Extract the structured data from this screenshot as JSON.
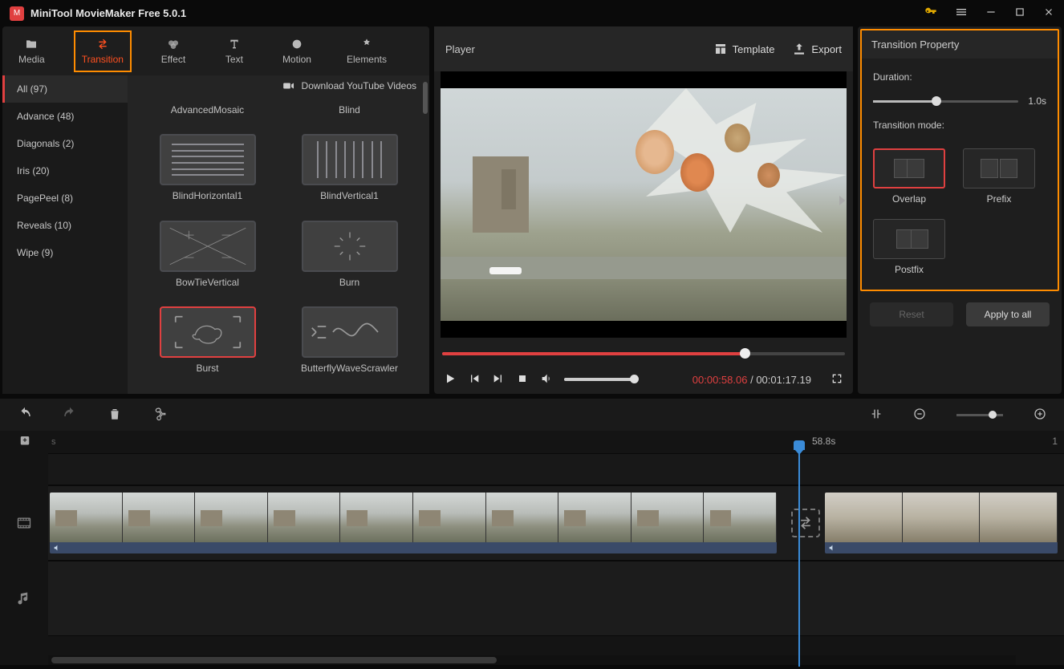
{
  "app": {
    "title": "MiniTool MovieMaker Free 5.0.1"
  },
  "tabs": [
    {
      "label": "Media"
    },
    {
      "label": "Transition"
    },
    {
      "label": "Effect"
    },
    {
      "label": "Text"
    },
    {
      "label": "Motion"
    },
    {
      "label": "Elements"
    }
  ],
  "categories": [
    {
      "label": "All (97)"
    },
    {
      "label": "Advance (48)"
    },
    {
      "label": "Diagonals (2)"
    },
    {
      "label": "Iris (20)"
    },
    {
      "label": "PagePeel (8)"
    },
    {
      "label": "Reveals (10)"
    },
    {
      "label": "Wipe (9)"
    }
  ],
  "download_link": "Download YouTube Videos",
  "transitions": [
    {
      "name": "AdvancedMosaic"
    },
    {
      "name": "Blind"
    },
    {
      "name": "BlindHorizontal1"
    },
    {
      "name": "BlindVertical1"
    },
    {
      "name": "BowTieVertical"
    },
    {
      "name": "Burn"
    },
    {
      "name": "Burst"
    },
    {
      "name": "ButterflyWaveScrawler"
    }
  ],
  "player": {
    "title": "Player",
    "template": "Template",
    "export": "Export",
    "current_time": "00:00:58.06",
    "total_time": "00:01:17.19"
  },
  "props": {
    "title": "Transition Property",
    "duration_label": "Duration:",
    "duration_value": "1.0s",
    "mode_label": "Transition mode:",
    "modes": {
      "overlap": "Overlap",
      "prefix": "Prefix",
      "postfix": "Postfix"
    },
    "reset": "Reset",
    "apply": "Apply to all"
  },
  "timeline": {
    "ruler_label": "s",
    "playhead_time": "58.8s",
    "right_edge": "1"
  }
}
